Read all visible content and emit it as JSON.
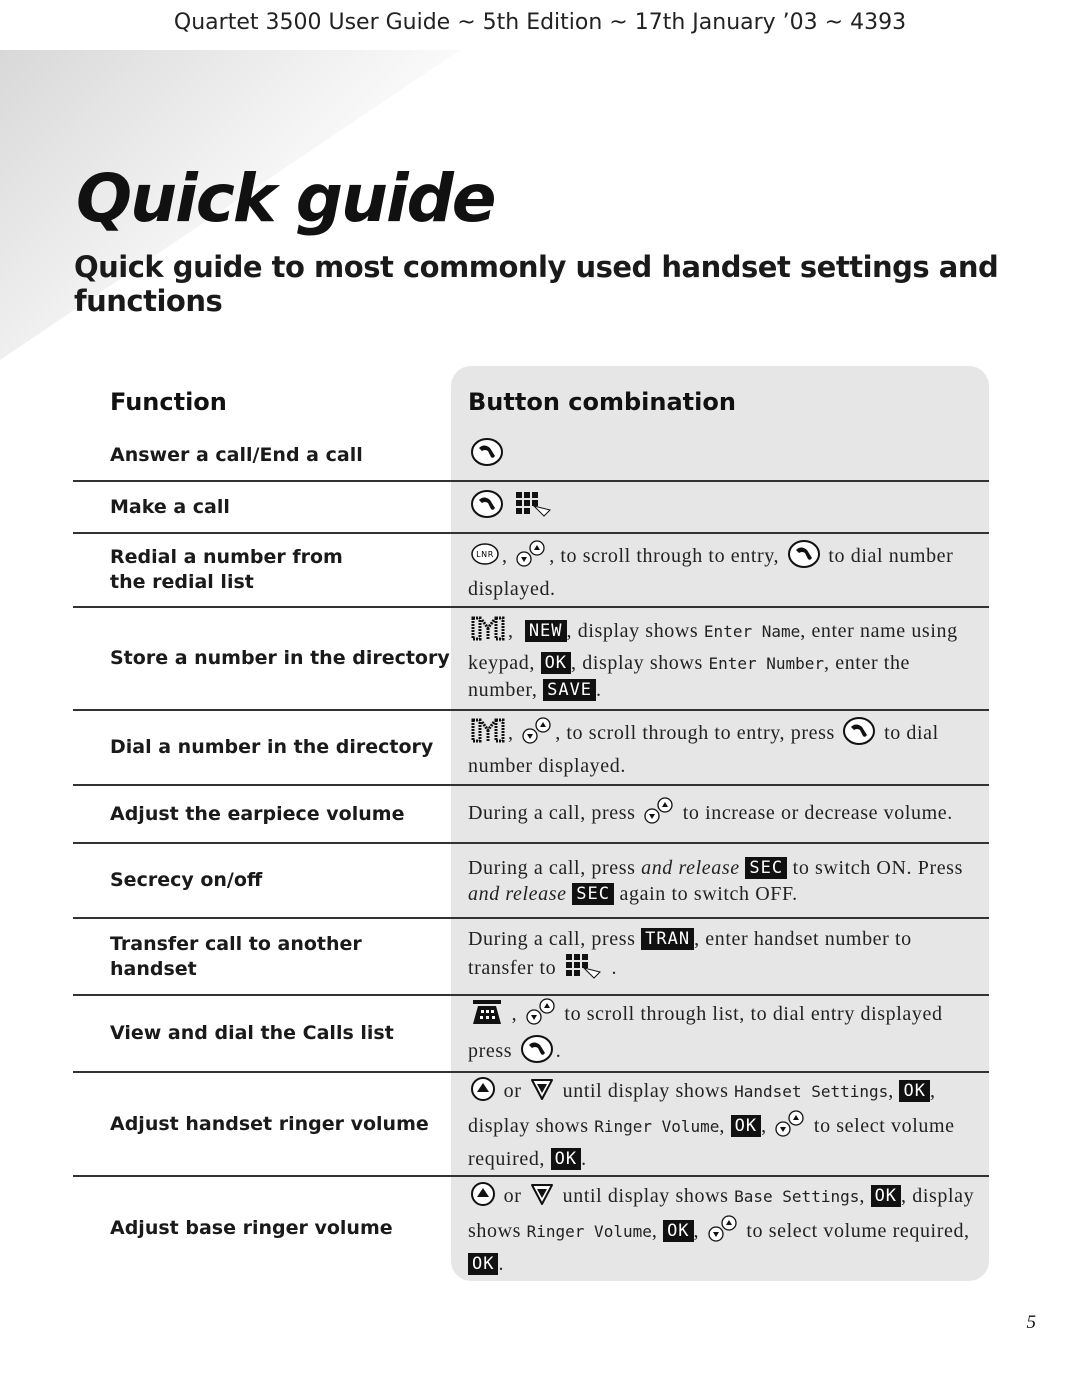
{
  "header": {
    "running_head": "Quartet 3500 User Guide ~ 5th Edition ~ 17th January ’03 ~ 4393"
  },
  "title": "Quick guide",
  "subtitle": "Quick guide to most commonly used handset settings and functions",
  "table": {
    "col_function": "Function",
    "col_buttons": "Button combination",
    "rows": [
      {
        "function": "Answer a call/End a call",
        "buttons": [
          {
            "icon": "phone-talk-icon"
          }
        ]
      },
      {
        "function": "Make a call",
        "buttons": [
          {
            "icon": "phone-talk-icon"
          },
          {
            "t": " "
          },
          {
            "icon": "keypad-icon"
          }
        ]
      },
      {
        "function": "Redial a number from the redial list",
        "buttons": [
          {
            "icon": "lnr-redial-icon"
          },
          {
            "t": ", "
          },
          {
            "icon": "scroll-updown-icon"
          },
          {
            "t": ", to scroll through to entry, "
          },
          {
            "icon": "phone-talk-icon"
          },
          {
            "t": " to dial number displayed."
          }
        ]
      },
      {
        "function": "Store a number in the directory",
        "buttons": [
          {
            "icon": "directory-icon"
          },
          {
            "t": ",  "
          },
          {
            "key": "NEW"
          },
          {
            "t": ", display shows "
          },
          {
            "lcd": "Enter Name"
          },
          {
            "t": ", enter name using keypad, "
          },
          {
            "key": "OK"
          },
          {
            "t": ", display shows "
          },
          {
            "lcd": "Enter Number"
          },
          {
            "t": ", enter the number, "
          },
          {
            "key": "SAVE"
          },
          {
            "t": "."
          }
        ]
      },
      {
        "function": "Dial a number in the directory",
        "buttons": [
          {
            "icon": "directory-icon"
          },
          {
            "t": ", "
          },
          {
            "icon": "scroll-updown-icon"
          },
          {
            "t": ", to scroll through to entry, press "
          },
          {
            "icon": "phone-talk-icon"
          },
          {
            "t": " to dial number displayed."
          }
        ]
      },
      {
        "function": "Adjust the earpiece volume",
        "buttons": [
          {
            "t": "During a call, press "
          },
          {
            "icon": "scroll-updown-icon"
          },
          {
            "t": " to increase or decrease volume."
          }
        ]
      },
      {
        "function": "Secrecy on/off",
        "buttons": [
          {
            "t": "During a call, press "
          },
          {
            "i": "and release"
          },
          {
            "t": " "
          },
          {
            "key": "SEC"
          },
          {
            "t": " to switch ON. Press "
          },
          {
            "i": "and release"
          },
          {
            "t": " "
          },
          {
            "key": "SEC"
          },
          {
            "t": " again to switch OFF."
          }
        ]
      },
      {
        "function": "Transfer call to another handset",
        "buttons": [
          {
            "t": "During a call, press "
          },
          {
            "key": "TRAN"
          },
          {
            "t": ", enter handset number to transfer to "
          },
          {
            "icon": "keypad-icon"
          },
          {
            "t": " ."
          }
        ]
      },
      {
        "function": "View and dial the Calls list",
        "buttons": [
          {
            "icon": "calls-list-icon"
          },
          {
            "t": " , "
          },
          {
            "icon": "scroll-updown-icon"
          },
          {
            "t": " to scroll through list, to dial entry displayed press "
          },
          {
            "icon": "phone-talk-icon"
          },
          {
            "t": "."
          }
        ]
      },
      {
        "function": "Adjust handset ringer volume",
        "buttons": [
          {
            "icon": "up-arrow-icon"
          },
          {
            "t": " or "
          },
          {
            "icon": "down-arrow-icon"
          },
          {
            "t": " until display shows "
          },
          {
            "lcd": "Handset Settings"
          },
          {
            "t": ", "
          },
          {
            "key": "OK"
          },
          {
            "t": ", display shows "
          },
          {
            "lcd": "Ringer Volume"
          },
          {
            "t": ", "
          },
          {
            "key": "OK"
          },
          {
            "t": ", "
          },
          {
            "icon": "scroll-updown-icon"
          },
          {
            "t": " to select volume required, "
          },
          {
            "key": "OK"
          },
          {
            "t": "."
          }
        ]
      },
      {
        "function": "Adjust base ringer volume",
        "buttons": [
          {
            "icon": "up-arrow-icon"
          },
          {
            "t": " or "
          },
          {
            "icon": "down-arrow-icon"
          },
          {
            "t": " until display shows "
          },
          {
            "lcd": "Base Settings"
          },
          {
            "t": ", "
          },
          {
            "key": "OK"
          },
          {
            "t": ", display shows "
          },
          {
            "lcd": "Ringer Volume"
          },
          {
            "t": ", "
          },
          {
            "key": "OK"
          },
          {
            "t": ", "
          },
          {
            "icon": "scroll-updown-icon"
          },
          {
            "t": " to select volume required, "
          },
          {
            "key": "OK"
          },
          {
            "t": "."
          }
        ]
      }
    ]
  },
  "page_number": "5"
}
